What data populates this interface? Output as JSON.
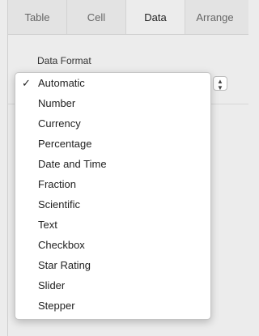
{
  "tabs": [
    {
      "label": "Table"
    },
    {
      "label": "Cell"
    },
    {
      "label": "Data"
    },
    {
      "label": "Arrange"
    }
  ],
  "active_tab": "Data",
  "section": {
    "label": "Data Format"
  },
  "stepper_glyph": "▲▼",
  "menu": {
    "selected": "Automatic",
    "checkmark": "✓",
    "items": [
      {
        "label": "Automatic"
      },
      {
        "label": "Number"
      },
      {
        "label": "Currency"
      },
      {
        "label": "Percentage"
      },
      {
        "label": "Date and Time"
      },
      {
        "label": "Fraction"
      },
      {
        "label": "Scientific"
      },
      {
        "label": "Text"
      },
      {
        "label": "Checkbox"
      },
      {
        "label": "Star Rating"
      },
      {
        "label": "Slider"
      },
      {
        "label": "Stepper"
      }
    ]
  }
}
